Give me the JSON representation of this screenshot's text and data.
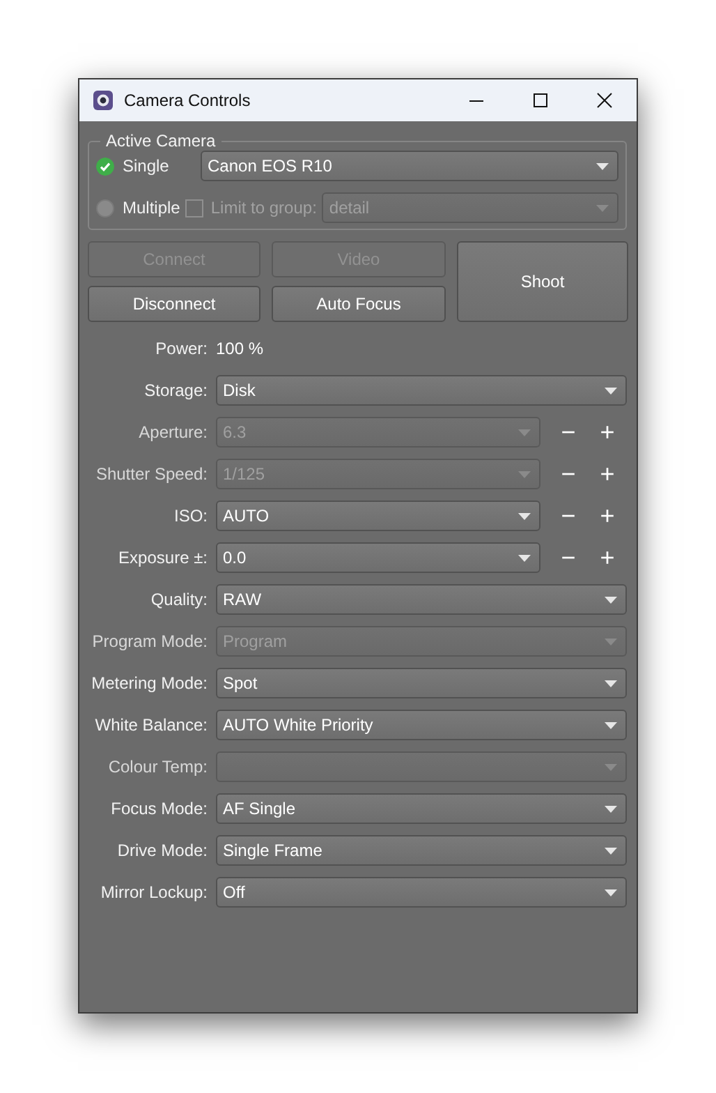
{
  "window": {
    "title": "Camera Controls"
  },
  "active_camera": {
    "title": "Active Camera",
    "single": {
      "label": "Single",
      "selected": true
    },
    "camera": {
      "value": "Canon EOS R10",
      "disabled": false
    },
    "multiple": {
      "label": "Multiple",
      "selected": false
    },
    "limit": {
      "label": "Limit to group:",
      "checked": false,
      "disabled": true
    },
    "group": {
      "value": "detail",
      "disabled": true
    }
  },
  "buttons": [
    {
      "label": "Connect",
      "disabled": true
    },
    {
      "label": "Video",
      "disabled": true
    },
    {
      "label": "Disconnect",
      "disabled": false
    },
    {
      "label": "Auto Focus",
      "disabled": false
    }
  ],
  "shoot": {
    "label": "Shoot",
    "disabled": false
  },
  "settings": [
    {
      "kind": "text",
      "label": "Power:",
      "value": "100 %"
    },
    {
      "kind": "combo",
      "label": "Storage:",
      "value": "Disk",
      "disabled": false
    },
    {
      "kind": "stepper",
      "label": "Aperture:",
      "value": "6.3",
      "disabled": true,
      "minus": "−",
      "plus": "+"
    },
    {
      "kind": "stepper",
      "label": "Shutter Speed:",
      "value": "1/125",
      "disabled": true,
      "minus": "−",
      "plus": "+"
    },
    {
      "kind": "stepper",
      "label": "ISO:",
      "value": "AUTO",
      "disabled": false,
      "minus": "−",
      "plus": "+"
    },
    {
      "kind": "stepper",
      "label": "Exposure ±:",
      "value": "0.0",
      "disabled": false,
      "minus": "−",
      "plus": "+"
    },
    {
      "kind": "combo",
      "label": "Quality:",
      "value": "RAW",
      "disabled": false
    },
    {
      "kind": "combo",
      "label": "Program Mode:",
      "value": "Program",
      "disabled": true
    },
    {
      "kind": "combo",
      "label": "Metering Mode:",
      "value": "Spot",
      "disabled": false
    },
    {
      "kind": "combo",
      "label": "White Balance:",
      "value": "AUTO White Priority",
      "disabled": false
    },
    {
      "kind": "combo",
      "label": "Colour Temp:",
      "disabled": true
    },
    {
      "kind": "combo",
      "label": "Focus Mode:",
      "value": "AF Single",
      "disabled": false
    },
    {
      "kind": "combo",
      "label": "Drive Mode:",
      "value": "Single Frame",
      "disabled": false
    },
    {
      "kind": "combo",
      "label": "Mirror Lockup:",
      "value": "Off",
      "disabled": false
    }
  ]
}
